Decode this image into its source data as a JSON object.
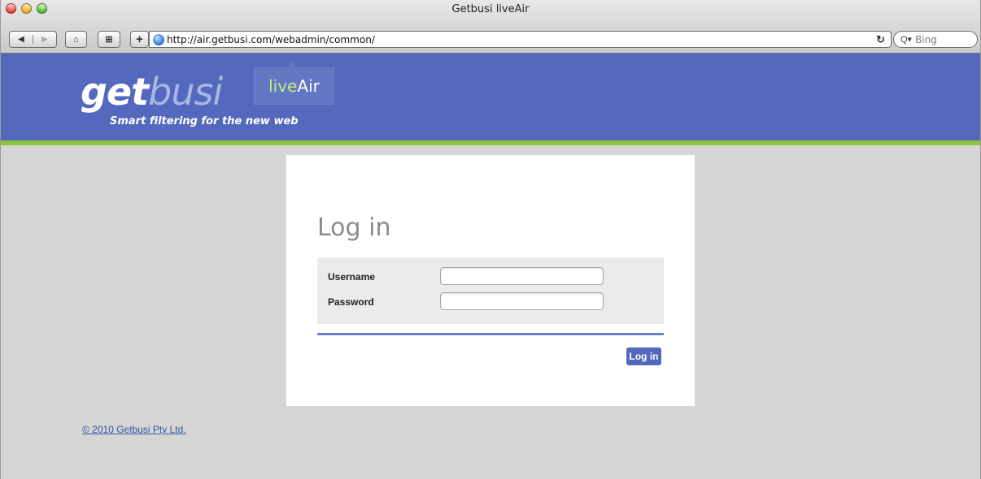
{
  "browser": {
    "window_title": "Getbusi liveAir",
    "url": "http://air.getbusi.com/webadmin/common/",
    "search_placeholder": "Bing",
    "back_glyph": "◀",
    "forward_glyph": "▶",
    "home_glyph": "⌂",
    "bookmarks_glyph": "⊞",
    "add_bookmark_glyph": "+",
    "reload_glyph": "↻",
    "search_glyph": "Q▾"
  },
  "header": {
    "logo_get": "get",
    "logo_busi": "busi",
    "tagline": "Smart filtering for the new web",
    "badge_live": "live",
    "badge_air": "Air",
    "colors": {
      "header_bg": "#5469bd",
      "accent_green": "#8cc63f"
    }
  },
  "login": {
    "title": "Log in",
    "username_label": "Username",
    "password_label": "Password",
    "username_value": "",
    "password_value": "",
    "submit_label": "Log in"
  },
  "footer": {
    "copyright": "© 2010 Getbusi Pty Ltd."
  }
}
